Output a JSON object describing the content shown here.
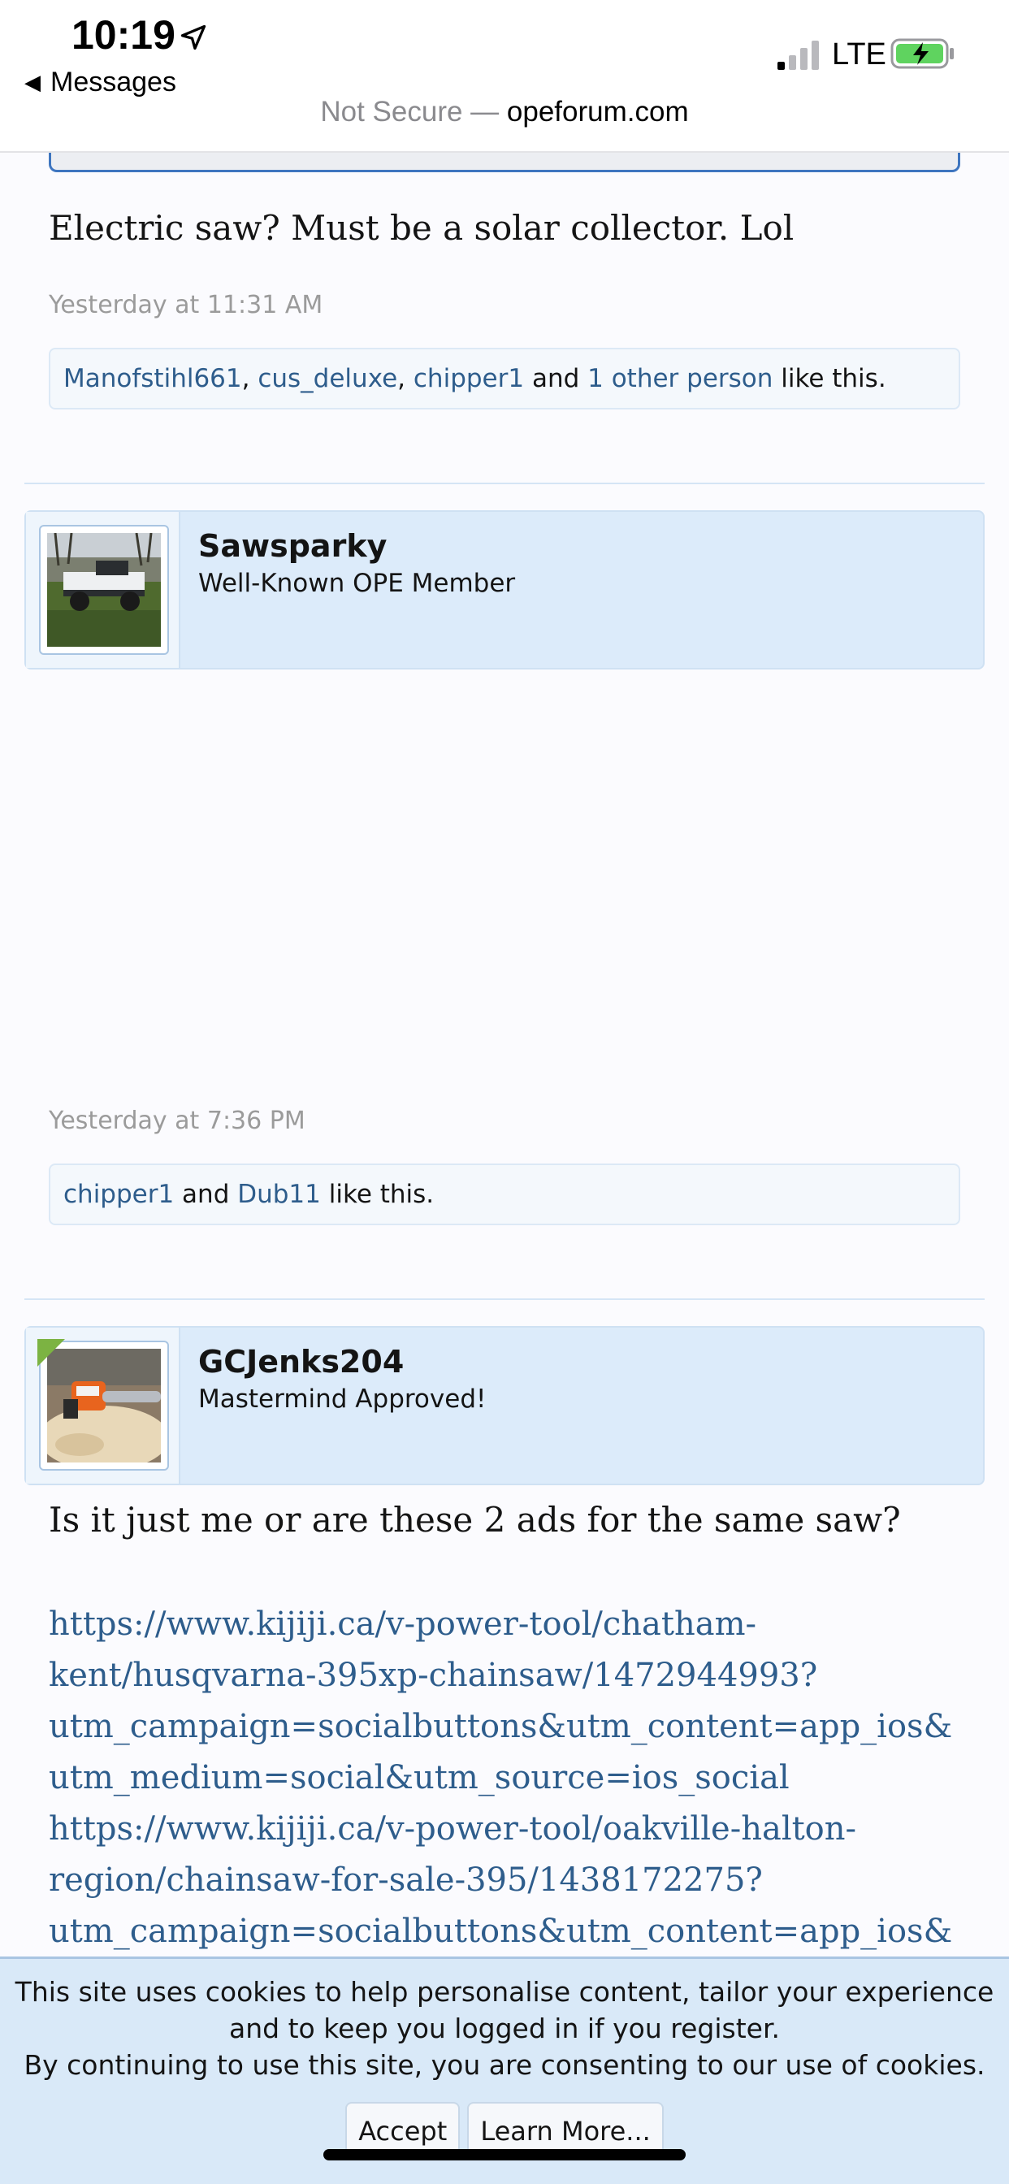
{
  "status_bar": {
    "time": "10:19",
    "back_label": "Messages",
    "network": "LTE"
  },
  "browser": {
    "not_secure": "Not Secure —",
    "domain": "opeforum.com"
  },
  "posts": [
    {
      "text": "Electric saw? Must be a solar collector. Lol",
      "date": "Yesterday at 11:31 AM",
      "likes": {
        "users": [
          "Manofstihl661",
          "cus_deluxe",
          "chipper1"
        ],
        "sep1": ", ",
        "sep2": ", ",
        "and": " and ",
        "others": "1 other person",
        "suffix": " like this."
      }
    },
    {
      "username": "Sawsparky",
      "user_title": "Well-Known OPE Member",
      "date": "Yesterday at 7:36 PM",
      "likes": {
        "users": [
          "chipper1",
          "Dub11"
        ],
        "and": " and ",
        "suffix": " like this."
      }
    },
    {
      "username": "GCJenks204",
      "user_title": "Mastermind Approved!",
      "text": "Is it just me or are these 2 ads for the same saw?",
      "link_lines": [
        "https://www.kijiji.ca/v-power-tool/chatham-",
        "kent/husqvarna-395xp-chainsaw/1472944993?",
        "utm_campaign=socialbuttons&utm_content=app_ios&",
        "utm_medium=social&utm_source=ios_social",
        "https://www.kijiji.ca/v-power-tool/oakville-halton-",
        "region/chainsaw-for-sale-395/1438172275?",
        "utm_campaign=socialbuttons&utm_content=app_ios&"
      ]
    }
  ],
  "cookie_notice": {
    "line1": "This site uses cookies to help personalise content, tailor your experience",
    "line2": "and to keep you logged in if you register.",
    "line3": "By continuing to use this site, you are consenting to our use of cookies.",
    "accept": "Accept",
    "learn_more": "Learn More..."
  },
  "colors": {
    "link": "#2e5d8c",
    "user_block_bg": "#dcebfa",
    "cookie_bg": "#d9e9f8",
    "quote_border": "#3e75bf"
  },
  "icons": [
    "location-arrow-icon",
    "back-triangle-icon",
    "signal-bars-icon",
    "battery-charging-icon"
  ]
}
